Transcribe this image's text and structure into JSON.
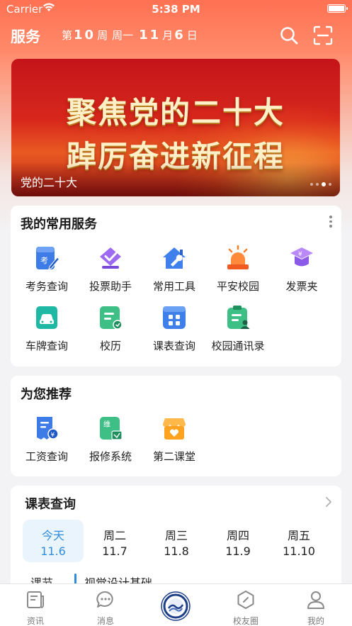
{
  "status_bar": {
    "carrier": "Carrier",
    "time": "5:38 PM"
  },
  "header": {
    "title": "服务",
    "week_prefix": "第",
    "week_number": "10",
    "week_suffix": "周",
    "weekday": "周一",
    "month": "11",
    "month_suffix": "月",
    "day": "6",
    "day_suffix": "日"
  },
  "banner": {
    "line1": "聚焦党的二十大",
    "line2": "踔厉奋进新征程",
    "caption": "党的二十大",
    "slide_count": 4,
    "active_slide": 3
  },
  "common_services": {
    "title": "我的常用服务",
    "items": [
      {
        "label": "考务查询",
        "icon": "exam-edit-icon"
      },
      {
        "label": "投票助手",
        "icon": "vote-check-icon"
      },
      {
        "label": "常用工具",
        "icon": "house-wrench-icon"
      },
      {
        "label": "平安校园",
        "icon": "alarm-light-icon"
      },
      {
        "label": "发票夹",
        "icon": "invoice-cap-icon"
      },
      {
        "label": "车牌查询",
        "icon": "car-plate-icon"
      },
      {
        "label": "校历",
        "icon": "calendar-doc-icon"
      },
      {
        "label": "课表查询",
        "icon": "timetable-icon"
      },
      {
        "label": "校园通讯录",
        "icon": "contacts-icon"
      }
    ]
  },
  "recommended": {
    "title": "为您推荐",
    "items": [
      {
        "label": "工资查询",
        "icon": "salary-receipt-icon"
      },
      {
        "label": "报修系统",
        "icon": "repair-doc-icon"
      },
      {
        "label": "第二课堂",
        "icon": "shop-heart-icon"
      }
    ]
  },
  "timetable": {
    "title": "课表查询",
    "days": [
      {
        "name": "今天",
        "date": "11.6"
      },
      {
        "name": "周二",
        "date": "11.7"
      },
      {
        "name": "周三",
        "date": "11.8"
      },
      {
        "name": "周四",
        "date": "11.9"
      },
      {
        "name": "周五",
        "date": "11.10"
      }
    ],
    "period_label": "课节",
    "course_name": "视觉设计基础"
  },
  "tab_bar": {
    "items": [
      {
        "label": "资讯",
        "icon": "news-icon"
      },
      {
        "label": "消息",
        "icon": "message-icon"
      },
      {
        "label": "",
        "icon": "school-logo-icon"
      },
      {
        "label": "校友圈",
        "icon": "alumni-icon"
      },
      {
        "label": "我的",
        "icon": "profile-icon"
      }
    ]
  },
  "colors": {
    "brand_gradient_top": "#ff7152",
    "accent_blue": "#2f8ddb",
    "today_bg": "#eaf4fd"
  }
}
